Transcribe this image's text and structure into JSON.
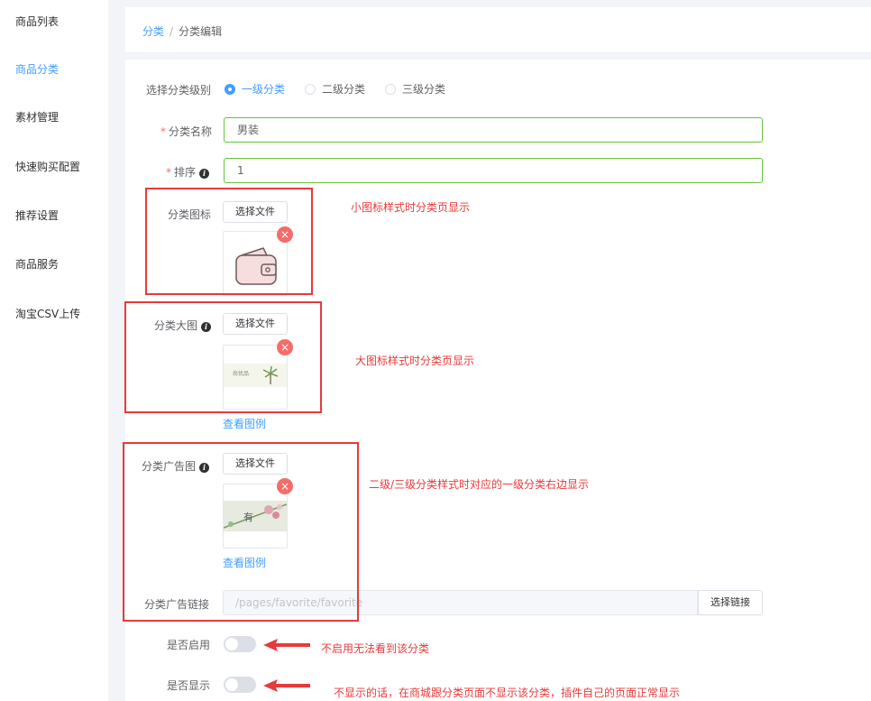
{
  "sidebar": {
    "items": [
      {
        "label": "商品列表"
      },
      {
        "label": "商品分类"
      },
      {
        "label": "素材管理"
      },
      {
        "label": "快速购买配置"
      },
      {
        "label": "推荐设置"
      },
      {
        "label": "商品服务"
      },
      {
        "label": "淘宝CSV上传"
      }
    ],
    "active_index": 1
  },
  "breadcrumb": {
    "parent": "分类",
    "separator": "/",
    "current": "分类编辑"
  },
  "form": {
    "level": {
      "label": "选择分类级别",
      "options": [
        "一级分类",
        "二级分类",
        "三级分类"
      ],
      "selected": "一级分类"
    },
    "name": {
      "required_mark": "*",
      "label": "分类名称",
      "value": "男装"
    },
    "sort": {
      "required_mark": "*",
      "label": "排序",
      "value": "1"
    },
    "icon": {
      "label": "分类图标",
      "button": "选择文件",
      "remove": "×"
    },
    "big_image": {
      "label": "分类大图",
      "button": "选择文件",
      "remove": "×",
      "example_link": "查看图例",
      "thumb_text": "尚优品"
    },
    "ad_image": {
      "label": "分类广告图",
      "button": "选择文件",
      "remove": "×",
      "example_link": "查看图例",
      "thumb_text": "有"
    },
    "ad_link": {
      "label": "分类广告链接",
      "placeholder": "/pages/favorite/favorite",
      "button": "选择链接"
    },
    "enabled": {
      "label": "是否启用",
      "value": false
    },
    "visible": {
      "label": "是否显示",
      "value": false
    }
  },
  "annotations": {
    "icon_note": "小图标样式时分类页显示",
    "big_image_note": "大图标样式时分类页显示",
    "ad_image_note": "二级/三级分类样式时对应的一级分类右边显示",
    "enabled_note": "不启用无法看到该分类",
    "visible_note": "不显示的话，在商城跟分类页面不显示该分类，插件自己的页面正常显示",
    "color": "#e83a3a"
  },
  "colors": {
    "primary": "#409eff",
    "success_border": "#67c23a",
    "danger": "#f56c6c"
  }
}
